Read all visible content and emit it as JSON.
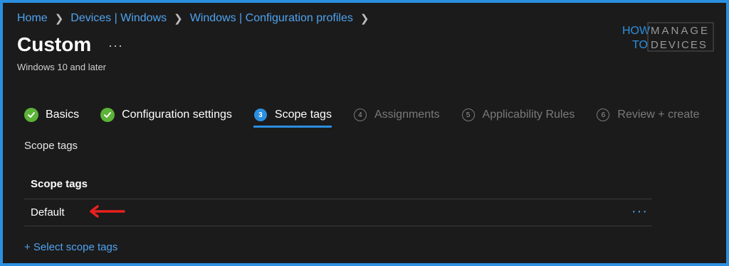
{
  "breadcrumb": [
    {
      "label": "Home"
    },
    {
      "label": "Devices | Windows"
    },
    {
      "label": "Windows | Configuration profiles"
    }
  ],
  "header": {
    "title": "Custom",
    "more": "···",
    "subtitle": "Windows 10 and later"
  },
  "logo": {
    "how": "HOW",
    "to": "TO",
    "manage": "MANAGE",
    "devices": "DEVICES"
  },
  "tabs": [
    {
      "label": "Basics",
      "state": "done",
      "icon": "check-icon"
    },
    {
      "label": "Configuration settings",
      "state": "done",
      "icon": "check-icon"
    },
    {
      "label": "Scope tags",
      "state": "active",
      "number": "3"
    },
    {
      "label": "Assignments",
      "state": "future",
      "number": "4"
    },
    {
      "label": "Applicability Rules",
      "state": "future",
      "number": "5"
    },
    {
      "label": "Review + create",
      "state": "future",
      "number": "6"
    }
  ],
  "main": {
    "section_label": "Scope tags",
    "table": {
      "header": "Scope tags",
      "rows": [
        {
          "value": "Default",
          "more": "···"
        }
      ]
    },
    "select_link": "+ Select scope tags"
  },
  "colors": {
    "accent": "#2b8fe0",
    "link": "#4fa3f0",
    "success": "#5cb338",
    "annotation": "#e8201e"
  }
}
